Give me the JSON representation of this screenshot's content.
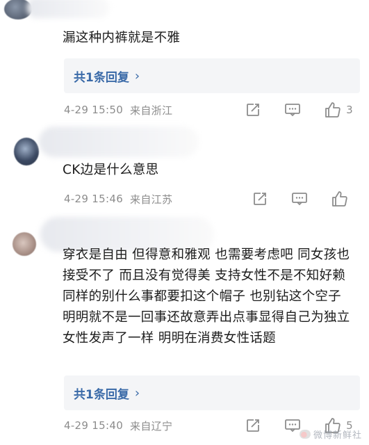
{
  "comments": [
    {
      "text": "漏这种内裤就是不雅",
      "reply_label": "共1条回复",
      "time": "4-29 15:50",
      "location": "来自浙江",
      "like_count": "3"
    },
    {
      "text": "CK边是什么意思",
      "time": "4-29 15:46",
      "location": "来自江苏",
      "like_count": ""
    },
    {
      "text": "穿衣是自由 但得意和雅观 也需要考虑吧 同女孩也接受不了 而且没有觉得美 支持女性不是不知好赖 同样的别什么事都要扣这个帽子 也别钻这个空子 明明就不是一回事还故意弄出点事显得自己为独立女性发声了一样 明明在消费女性话题",
      "reply_label": "共1条回复",
      "time": "4-29 15:40",
      "location": "来自辽宁",
      "like_count": "5"
    }
  ],
  "reply_chevron": "›",
  "icons": {
    "share": "share-icon",
    "comment": "comment-icon",
    "like": "thumbs-up-icon"
  },
  "watermark": {
    "text": "微博新鲜社"
  },
  "colors": {
    "link": "#3a6aa8",
    "meta": "#8c8c8c",
    "reply_bg": "#f4f5f7"
  }
}
